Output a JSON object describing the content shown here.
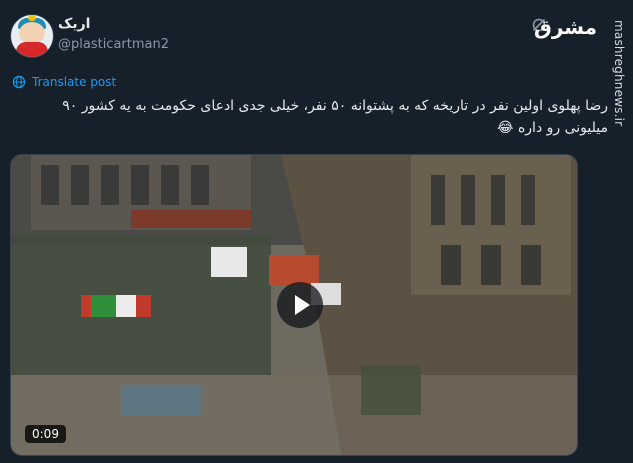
{
  "user": {
    "display_name": "اریک",
    "handle": "@plasticartman2"
  },
  "header": {
    "logo_text": "مشرق",
    "watermark": "mashreghnews.ir"
  },
  "translate": {
    "label": "Translate post"
  },
  "tweet": {
    "text": "رضا پهلوی اولین نفر در تاریخه که به پشتوانه ۵۰ نفر، خیلی جدی ادعای حکومت به یه کشور ۹۰ میلیونی رو داره 😂"
  },
  "media": {
    "duration": "0:09"
  },
  "icons": {
    "grok": "grok-icon",
    "translate": "globe-icon",
    "play": "play-icon"
  },
  "colors": {
    "background": "#15202b",
    "link": "#1d9bf0",
    "secondary_text": "#8b98a5"
  }
}
